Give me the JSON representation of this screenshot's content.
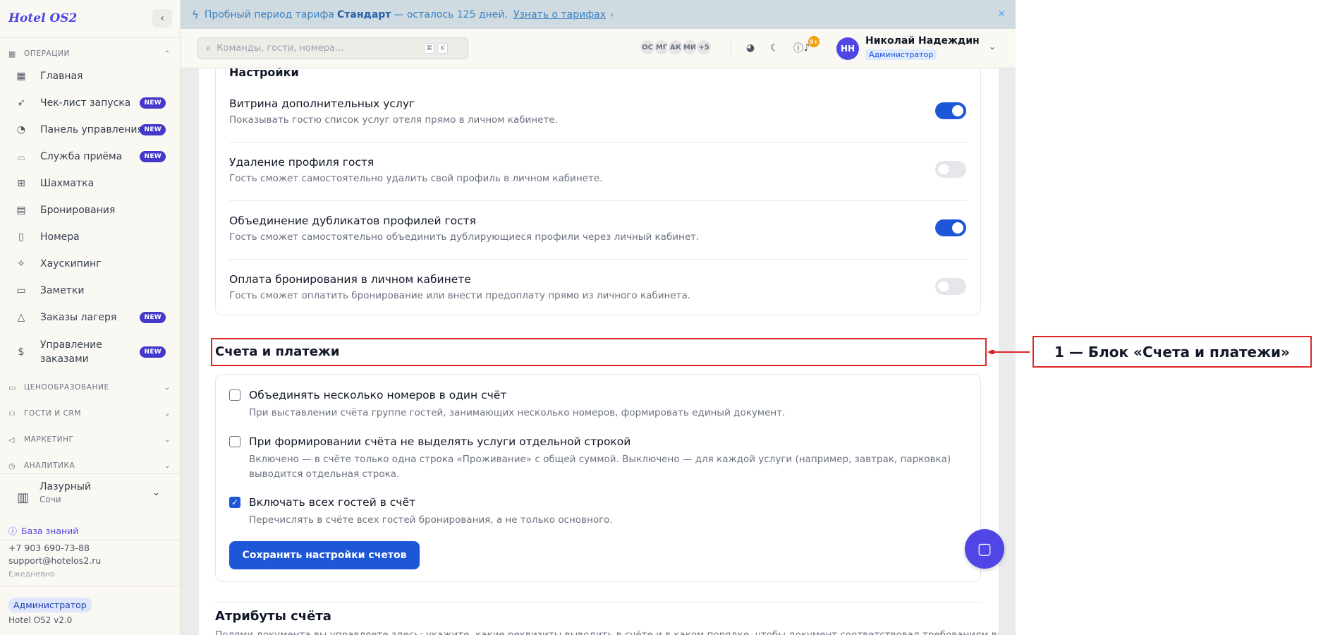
{
  "sidebar": {
    "brand": "Hotel OS2",
    "sections": {
      "operations": "ОПЕРАЦИИ",
      "pricing": "ЦЕНООБРАЗОВАНИЕ",
      "guests_crm": "ГОСТИ И CRM",
      "marketing": "МАРКЕТИНГ",
      "analytics": "АНАЛИТИКА"
    },
    "items": [
      {
        "label": "Главная",
        "icon": "dashboard-grid-icon",
        "new": false
      },
      {
        "label": "Чек-лист запуска",
        "icon": "rocket-icon",
        "new": true
      },
      {
        "label": "Панель управления",
        "icon": "gauge-icon",
        "new": true
      },
      {
        "label": "Служба приёма",
        "icon": "reception-bell-icon",
        "new": true
      },
      {
        "label": "Шахматка",
        "icon": "grid-table-icon",
        "new": false
      },
      {
        "label": "Бронирования",
        "icon": "clipboard-icon",
        "new": false
      },
      {
        "label": "Номера",
        "icon": "door-icon",
        "new": false
      },
      {
        "label": "Хаускипинг",
        "icon": "sparkle-icon",
        "new": false
      },
      {
        "label": "Заметки",
        "icon": "note-icon",
        "new": false
      },
      {
        "label": "Заказы лагеря",
        "icon": "tent-icon",
        "new": true
      },
      {
        "label_line1": "Управление",
        "label_line2": "заказами",
        "icon": "order-icon",
        "new": true
      }
    ],
    "badge_new": "NEW",
    "hotel": {
      "name": "Лазурный",
      "city": "Сочи"
    },
    "knowledge_base": "База знаний",
    "phone": "+7 903 690-73-88",
    "email": "support@hotelos2.ru",
    "schedule": "Ежедневно",
    "role": "Администратор",
    "version": "Hotel OS2 v2.0"
  },
  "banner": {
    "text_before": "Пробный период тарифа",
    "plan": "Стандарт",
    "text_after": "— осталось 125 дней.",
    "link": "Узнать о тарифах"
  },
  "header": {
    "search_placeholder": "Команды, гости, номера...",
    "kbd1": "⌘",
    "kbd2": "K",
    "avatars": [
      "ОС",
      "МГ",
      "АК",
      "МИ",
      "+5"
    ],
    "notif_count": "9+",
    "user_initials": "НН",
    "user_name": "Николай Надеждин",
    "user_role": "Администратор"
  },
  "settings": {
    "title": "Настройки",
    "toggles": [
      {
        "title": "Витрина дополнительных услуг",
        "desc": "Показывать гостю список услуг отеля прямо в личном кабинете.",
        "on": true
      },
      {
        "title": "Удаление профиля гостя",
        "desc": "Гость сможет самостоятельно удалить свой профиль в личном кабинете.",
        "on": false
      },
      {
        "title": "Объединение дубликатов профилей гостя",
        "desc": "Гость сможет самостоятельно объединить дублирующиеся профили через личный кабинет.",
        "on": true
      },
      {
        "title": "Оплата бронирования в личном кабинете",
        "desc": "Гость сможет оплатить бронирование или внести предоплату прямо из личного кабинета.",
        "on": false
      }
    ]
  },
  "invoices": {
    "title": "Счета и платежи",
    "options": [
      {
        "title": "Объединять несколько номеров в один счёт",
        "desc": "При выставлении счёта группе гостей, занимающих несколько номеров, формировать единый документ.",
        "checked": false
      },
      {
        "title": "При формировании счёта не выделять услуги отдельной строкой",
        "desc": "Включено — в счёте только одна строка «Проживание» с общей суммой. Выключено — для каждой услуги (например, завтрак, парковка) выводится отдельная строка.",
        "checked": false
      },
      {
        "title": "Включать всех гостей в счёт",
        "desc": "Перечислять в счёте всех гостей бронирования, а не только основного.",
        "checked": true
      }
    ],
    "save_button": "Сохранить настройки счетов"
  },
  "attributes": {
    "title": "Атрибуты счёта",
    "desc": "Полями документа вы управляете здесь: укажите, какие реквизиты выводить в счёте и в каком порядке, чтобы документ соответствовал требованиям вашей бухгалтерии и партнёров."
  },
  "annotation": {
    "label": "1 — Блок «Счета и платежи»",
    "color": "#dc2626"
  }
}
